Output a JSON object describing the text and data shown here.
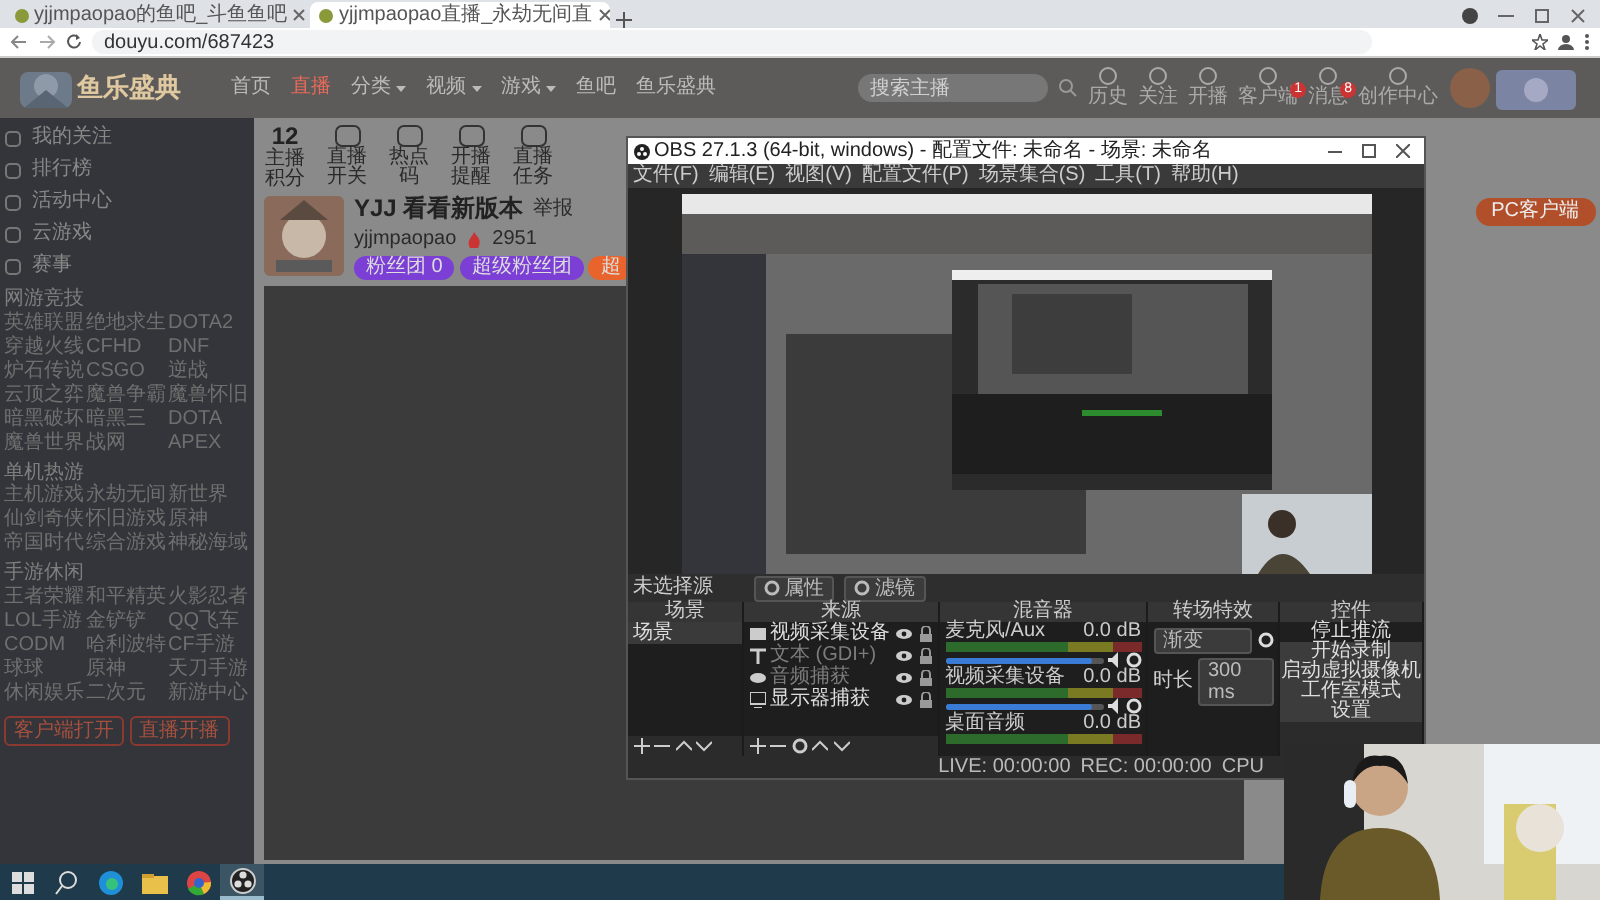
{
  "browser": {
    "tabs": [
      {
        "title": "yjjmpaopao的鱼吧_斗鱼鱼吧",
        "selected": false
      },
      {
        "title": "yjjmpaopao直播_永劫无间直",
        "selected": true
      }
    ],
    "url": "douyu.com/687423"
  },
  "site": {
    "logo": "鱼乐盛典",
    "nav": [
      {
        "label": "首页",
        "selected": false,
        "dropdown": false
      },
      {
        "label": "直播",
        "selected": true,
        "dropdown": false
      },
      {
        "label": "分类",
        "selected": false,
        "dropdown": true
      },
      {
        "label": "视频",
        "selected": false,
        "dropdown": true
      },
      {
        "label": "游戏",
        "selected": false,
        "dropdown": true
      },
      {
        "label": "鱼吧",
        "selected": false,
        "dropdown": false
      },
      {
        "label": "鱼乐盛典",
        "selected": false,
        "dropdown": false
      }
    ],
    "search": {
      "placeholder": "搜索主播"
    },
    "header_links": [
      {
        "label": "历史"
      },
      {
        "label": "关注"
      },
      {
        "label": "开播"
      },
      {
        "label": "客户端",
        "badge": "1"
      },
      {
        "label": "消息",
        "badge": "8"
      },
      {
        "label": "创作中心"
      }
    ]
  },
  "sidebar": {
    "top": [
      "我的关注",
      "排行榜",
      "活动中心",
      "云游戏",
      "赛事"
    ],
    "sections": [
      {
        "title": "网游竞技",
        "items": [
          "英雄联盟",
          "绝地求生",
          "DOTA2",
          "穿越火线",
          "CFHD",
          "DNF",
          "炉石传说",
          "CSGO",
          "逆战",
          "云顶之弈",
          "魔兽争霸",
          "魔兽怀旧",
          "暗黑破坏",
          "暗黑三",
          "DOTA",
          "魔兽世界",
          "战网",
          "APEX"
        ]
      },
      {
        "title": "单机热游",
        "items": [
          "主机游戏",
          "永劫无间",
          "新世界",
          "仙剑奇侠",
          "怀旧游戏",
          "原神",
          "帝国时代",
          "综合游戏",
          "神秘海域"
        ]
      },
      {
        "title": "手游休闲",
        "items": [
          "王者荣耀",
          "和平精英",
          "火影忍者",
          "LOL手游",
          "金铲铲",
          "QQ飞车",
          "CODM",
          "哈利波特",
          "CF手游",
          "球球",
          "原神",
          "天刀手游",
          "休闲娱乐",
          "二次元",
          "新游中心"
        ]
      }
    ],
    "buttons": [
      "客户端打开",
      "直播开播"
    ]
  },
  "toolbar": {
    "score": "12",
    "score_label": "主播积分",
    "items": [
      "直播开关",
      "热点码",
      "开播提醒",
      "直播任务"
    ]
  },
  "room": {
    "title": "YJJ 看看新版本",
    "report": "举报",
    "streamer": "yjjmpaopao",
    "heat": "2951",
    "tags": [
      {
        "label": "粉丝团 0",
        "color": "#7b3fd6"
      },
      {
        "label": "超级粉丝团",
        "color": "#7b3fd6"
      },
      {
        "label": "超",
        "color": "#e8642c"
      }
    ]
  },
  "right": {
    "pc_button": "PC客户端"
  },
  "obs": {
    "title": "OBS 27.1.3 (64-bit, windows) - 配置文件: 未命名 - 场景: 未命名",
    "menu": [
      "文件(F)",
      "编辑(E)",
      "视图(V)",
      "配置文件(P)",
      "场景集合(S)",
      "工具(T)",
      "帮助(H)"
    ],
    "source_bar": {
      "label": "未选择源",
      "buttons": [
        "属性",
        "滤镜"
      ]
    },
    "docks": [
      "场景",
      "来源",
      "混音器",
      "转场特效",
      "控件"
    ],
    "scenes": [
      {
        "name": "场景",
        "selected": true
      }
    ],
    "sources": [
      {
        "kind": "camera",
        "name": "视频采集设备",
        "active": true
      },
      {
        "kind": "text",
        "name": "文本 (GDI+)",
        "active": false
      },
      {
        "kind": "audio",
        "name": "音频捕获",
        "active": false
      },
      {
        "kind": "monitor",
        "name": "显示器捕获",
        "active": true
      }
    ],
    "mixer": [
      {
        "name": "麦克风/Aux",
        "reading": "0.0 dB",
        "level": 0.93
      },
      {
        "name": "视频采集设备",
        "reading": "0.0 dB",
        "level": 0.93
      },
      {
        "name": "桌面音频",
        "reading": "0.0 dB"
      }
    ],
    "transition": {
      "type": "渐变",
      "duration_label": "时长",
      "duration": "300 ms"
    },
    "controls": [
      "停止推流",
      "开始录制",
      "启动虚拟摄像机",
      "工作室模式",
      "设置"
    ],
    "status": {
      "live": "LIVE: 00:00:00",
      "rec": "REC: 00:00:00",
      "cpu": "CPU"
    }
  },
  "taskbar": [
    {
      "kind": "start",
      "selected": false
    },
    {
      "kind": "search",
      "selected": false
    },
    {
      "kind": "edge",
      "selected": false
    },
    {
      "kind": "folder",
      "selected": false
    },
    {
      "kind": "chrome",
      "selected": false
    },
    {
      "kind": "obs",
      "selected": true
    }
  ]
}
